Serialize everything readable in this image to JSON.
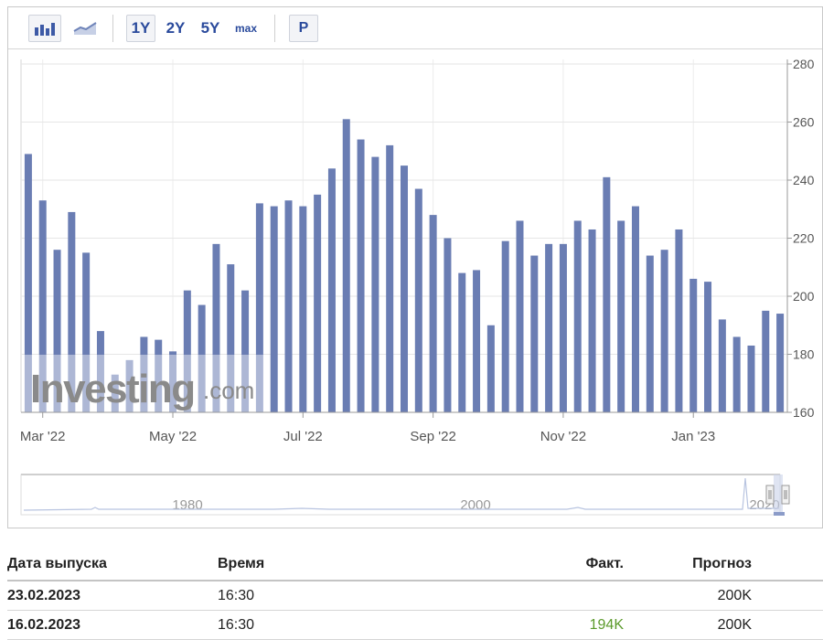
{
  "toolbar": {
    "ranges": [
      "1Y",
      "2Y",
      "5Y",
      "max"
    ],
    "p_label": "P"
  },
  "watermark": "Investing.com",
  "chart_data": {
    "type": "bar",
    "color": "#6a7db3",
    "ylim": [
      160,
      280
    ],
    "yticks": [
      160,
      180,
      200,
      220,
      240,
      260,
      280
    ],
    "xtick_labels": [
      {
        "label": "Mar '22",
        "index": 1
      },
      {
        "label": "May '22",
        "index": 10
      },
      {
        "label": "Jul '22",
        "index": 19
      },
      {
        "label": "Sep '22",
        "index": 28
      },
      {
        "label": "Nov '22",
        "index": 37
      },
      {
        "label": "Jan '23",
        "index": 46
      }
    ],
    "values": [
      249,
      233,
      216,
      229,
      215,
      188,
      173,
      178,
      186,
      185,
      181,
      202,
      197,
      218,
      211,
      202,
      232,
      231,
      233,
      231,
      235,
      244,
      261,
      254,
      248,
      252,
      245,
      237,
      228,
      220,
      208,
      209,
      190,
      219,
      226,
      214,
      218,
      218,
      226,
      223,
      241,
      226,
      231,
      214,
      216,
      223,
      206,
      205,
      192,
      186,
      183,
      195,
      194
    ],
    "navigator": {
      "labels": [
        "1980",
        "2000",
        "2020"
      ]
    }
  },
  "table": {
    "headers": {
      "date": "Дата выпуска",
      "time": "Время",
      "actual": "Факт.",
      "forecast": "Прогноз"
    },
    "rows": [
      {
        "date": "23.02.2023",
        "time": "16:30",
        "actual": "",
        "forecast": "200K"
      },
      {
        "date": "16.02.2023",
        "time": "16:30",
        "actual": "194K",
        "forecast": "200K"
      }
    ],
    "actual_color": "#5b9a2b"
  }
}
